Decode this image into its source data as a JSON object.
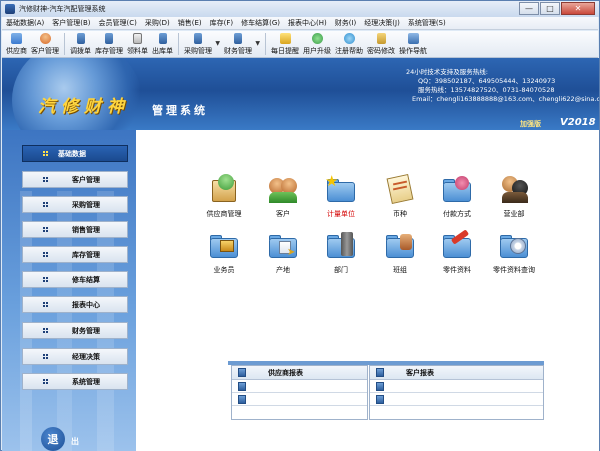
{
  "window": {
    "title": "汽修财神-汽车汽配管理系统",
    "buttons": {
      "minimize": "—",
      "maximize": "□",
      "close": "✕"
    }
  },
  "menu": [
    "基础数据(A)",
    "客户管理(B)",
    "会员管理(C)",
    "采购(D)",
    "销售(E)",
    "库存(F)",
    "修车结算(G)",
    "报表中心(H)",
    "财务(I)",
    "经理决策(J)",
    "系统管理(S)"
  ],
  "toolbar": {
    "items": [
      {
        "label": "供应商",
        "icon": "supplier-icon",
        "color": "#3c7bd0"
      },
      {
        "label": "客户管理",
        "icon": "customer-icon",
        "color": "#d86a2a"
      },
      {
        "label": "调拨单",
        "icon": "transfer-icon",
        "color": "#2f5f9e"
      },
      {
        "label": "库存管理",
        "icon": "inventory-icon",
        "color": "#4a7f3a"
      },
      {
        "label": "领料单",
        "icon": "requisition-icon",
        "color": "#8a6a2a"
      },
      {
        "label": "出库单",
        "icon": "outbound-icon",
        "color": "#2f5f9e"
      },
      {
        "label": "采购管理",
        "icon": "purchase-icon",
        "color": "#2f5f9e",
        "dropdown": true
      },
      {
        "label": "财务管理",
        "icon": "finance-icon",
        "color": "#2f5f9e",
        "dropdown": true
      },
      {
        "label": "每日提醒",
        "icon": "reminder-icon",
        "color": "#d9a520"
      },
      {
        "label": "用户升级",
        "icon": "upgrade-icon",
        "color": "#3b9c4a"
      },
      {
        "label": "注册帮助",
        "icon": "help-icon",
        "color": "#2f8fd0"
      },
      {
        "label": "密码修改",
        "icon": "password-icon",
        "color": "#c69a2f"
      },
      {
        "label": "操作导航",
        "icon": "navigation-icon",
        "color": "#3a6fb0"
      }
    ]
  },
  "banner": {
    "brand": "汽修财神",
    "subtitle": "管理系统",
    "contact_title": "24小时技术支持及服务热线:",
    "qq": "QQ：398502187、649505444、13240973",
    "hotline": "服务热线：13574827520、0731-84070528",
    "email": "Email：chengli163888888@163.com、chengli622@sina.com",
    "edition": "加强版",
    "version": "V2018"
  },
  "sidebar": {
    "items": [
      {
        "label": "基础数据",
        "active": true
      },
      {
        "label": "客户管理"
      },
      {
        "label": "采购管理"
      },
      {
        "label": "销售管理"
      },
      {
        "label": "库存管理"
      },
      {
        "label": "修车结算"
      },
      {
        "label": "报表中心"
      },
      {
        "label": "财务管理"
      },
      {
        "label": "经理决策"
      },
      {
        "label": "系统管理"
      }
    ],
    "exit_icon_text": "退",
    "exit_label": "出"
  },
  "main": {
    "icons_row1": [
      {
        "label": "供应商管理",
        "icon": "supplier-book-icon"
      },
      {
        "label": "客户",
        "icon": "customers-people-icon"
      },
      {
        "label": "计量单位",
        "icon": "unit-star-folder-icon",
        "highlight": true
      },
      {
        "label": "币种",
        "icon": "currency-clipboard-icon"
      },
      {
        "label": "付款方式",
        "icon": "payment-folder-icon"
      },
      {
        "label": "营业部",
        "icon": "branch-people-icon"
      }
    ],
    "icons_row2": [
      {
        "label": "业务员",
        "icon": "salesman-folder-icon"
      },
      {
        "label": "产地",
        "icon": "origin-folder-icon"
      },
      {
        "label": "部门",
        "icon": "department-folder-icon"
      },
      {
        "label": "班组",
        "icon": "team-folder-icon"
      },
      {
        "label": "零件资料",
        "icon": "parts-folder-icon"
      },
      {
        "label": "零件资料查询",
        "icon": "parts-search-disc-icon"
      }
    ],
    "reports": [
      {
        "title": "供应商报表",
        "rows": 3
      },
      {
        "title": "客户报表",
        "rows": 3
      }
    ]
  }
}
